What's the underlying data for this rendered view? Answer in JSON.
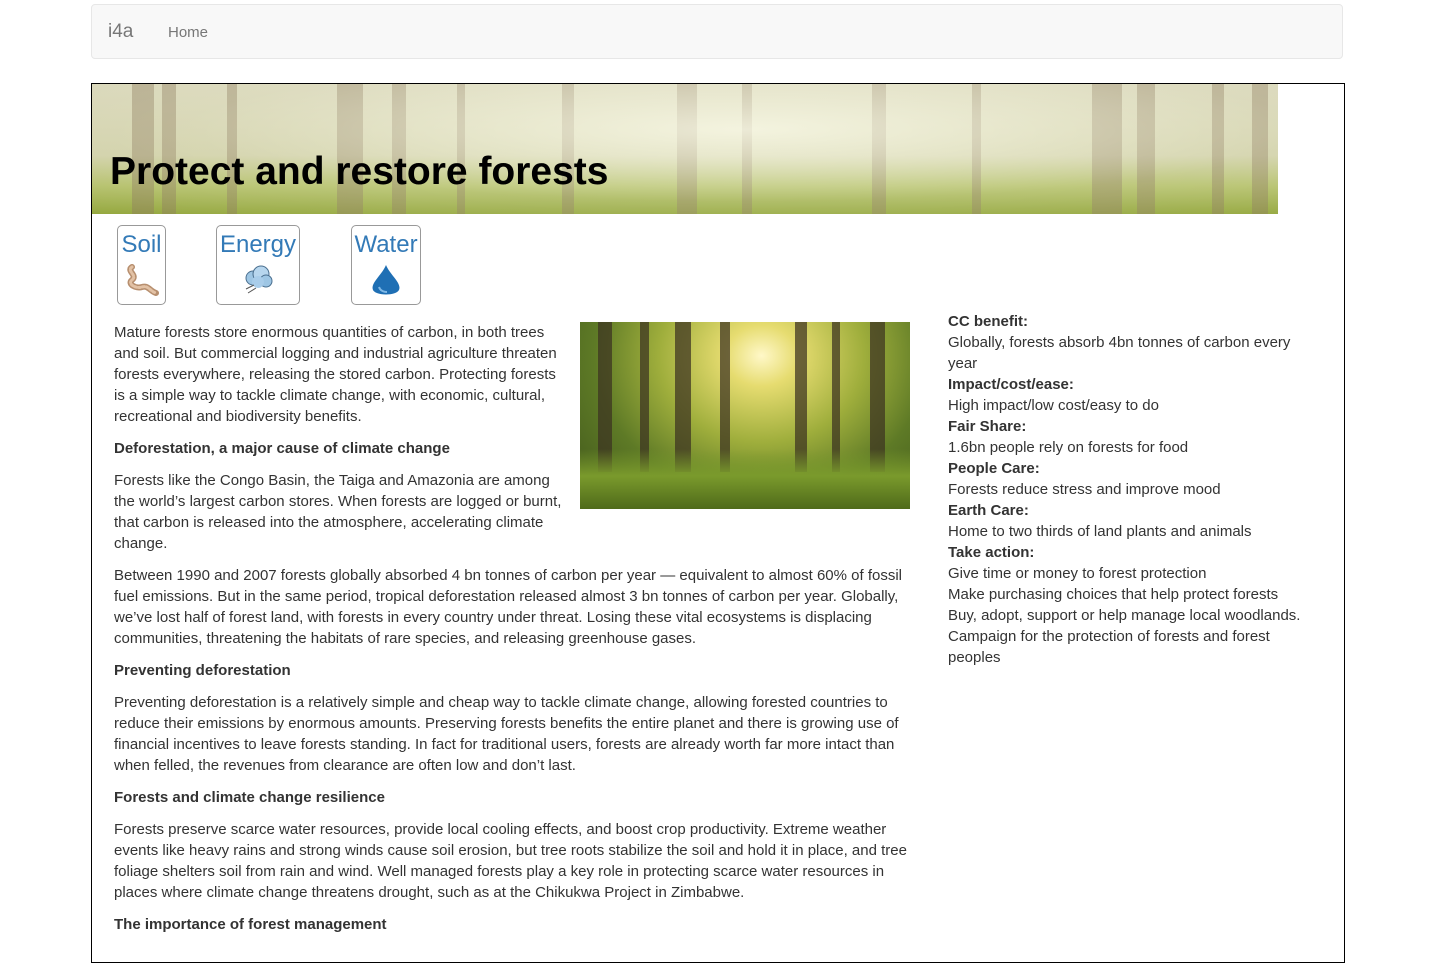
{
  "nav": {
    "brand": "i4a",
    "home": "Home"
  },
  "page": {
    "title": "Protect and restore forests"
  },
  "tags": [
    {
      "label": "Soil",
      "icon": "worm-icon"
    },
    {
      "label": "Energy",
      "icon": "wind-cloud-icon"
    },
    {
      "label": "Water",
      "icon": "water-drop-icon"
    }
  ],
  "article": {
    "intro": "Mature forests store enormous quantities of carbon, in both trees and soil. But commercial logging and industrial agriculture threaten forests everywhere, releasing the stored carbon. Protecting forests is a simple way to tackle climate change, with economic, cultural, recreational and biodiversity benefits.",
    "h1": "Deforestation, a major cause of climate change",
    "p1": "Forests like the Congo Basin, the Taiga and Amazonia are among the world’s largest carbon stores. When forests are logged or burnt, that carbon is released into the atmosphere, accelerating climate change.",
    "p2": "Between 1990 and 2007 forests globally absorbed 4 bn tonnes of carbon per year — equivalent to almost 60% of fossil fuel emissions. But in the same period, tropical deforestation released almost 3 bn tonnes of carbon per year. Globally, we’ve lost half of forest land, with forests in every country under threat. Losing these vital ecosystems is displacing communities, threatening the habitats of rare species, and releasing greenhouse gases.",
    "h2": "Preventing deforestation",
    "p3": "Preventing deforestation is a relatively simple and cheap way to tackle climate change, allowing forested countries to reduce their emissions by enormous amounts. Preserving forests benefits the entire planet and there is growing use of financial incentives to leave forests standing. In fact for traditional users, forests are already worth far more intact than when felled, the revenues from clearance are often low and don’t last.",
    "h3": "Forests and climate change resilience",
    "p4": "Forests preserve scarce water resources, provide local cooling effects, and boost crop productivity. Extreme weather events like heavy rains and strong winds cause soil erosion, but tree roots stabilize the soil and hold it in place, and tree foliage shelters soil from rain and wind. Well managed forests play a key role in protecting scarce water resources in places where climate change threatens drought, such as at the Chikukwa Project in Zimbabwe.",
    "h4": "The importance of forest management"
  },
  "sidebar": {
    "cc_label": "CC benefit:",
    "cc_value": "Globally, forests absorb 4bn tonnes of carbon every year",
    "impact_label": "Impact/cost/ease:",
    "impact_value": "High impact/low cost/easy to do",
    "fair_label": "Fair Share:",
    "fair_value": "1.6bn people rely on forests for food",
    "people_label": "People Care:",
    "people_value": "Forests reduce stress and improve mood",
    "earth_label": "Earth Care:",
    "earth_value": "Home to two thirds of land plants and animals",
    "action_label": "Take action:",
    "actions": [
      "Give time or money to forest protection",
      "Make purchasing choices that help protect forests",
      "Buy, adopt, support or help manage local woodlands.",
      "Campaign for the protection of forests and forest peoples"
    ]
  },
  "colors": {
    "link": "#337ab7",
    "text": "#333333",
    "navbar_bg": "#f8f8f8"
  }
}
